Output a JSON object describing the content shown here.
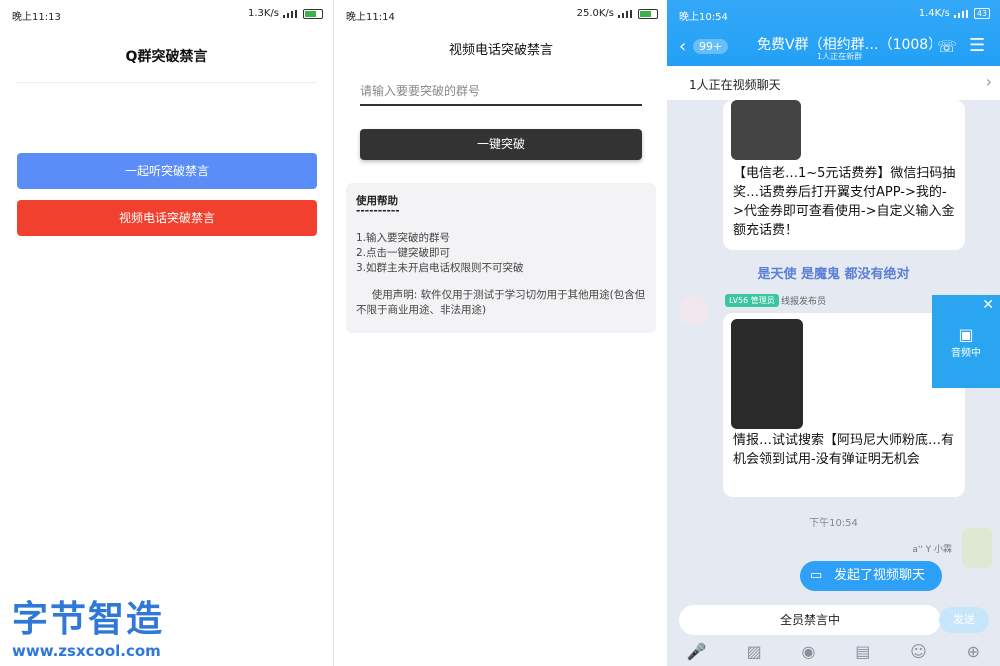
{
  "panel1": {
    "status": {
      "time": "晚上11:13",
      "speed": "1.3K/s"
    },
    "title": "Q群突破禁言",
    "buttons": {
      "listen": "一起听突破禁言",
      "video": "视频电话突破禁言"
    },
    "watermark": {
      "brand": "字节智造",
      "url": "www.zsxcool.com"
    },
    "colors": {
      "listen_btn": "#5b8df8",
      "video_btn": "#f2402f"
    }
  },
  "panel2": {
    "status": {
      "time": "晚上11:14",
      "speed": "25.0K/s"
    },
    "title": "视频电话突破禁言",
    "input_placeholder": "请输入要要突破的群号",
    "button": "一键突破",
    "help": {
      "title": "使用帮助",
      "divider": "----------",
      "steps": [
        "1.输入要突破的群号",
        "2.点击一键突破即可",
        "3.如群主未开启电话权限则不可突破"
      ],
      "disclaimer": "使用声明: 软件仅用于测试于学习切勿用于其他用途(包含但不限于商业用途、非法用途)"
    }
  },
  "panel3": {
    "status": {
      "time": "晚上10:54",
      "speed": "1.4K/s",
      "battery": "43"
    },
    "header": {
      "unread": "99+",
      "group_name": "免费V群（相约群…（1008）",
      "subtitle": "1人正在新群"
    },
    "video_bar": "1人正在视频聊天",
    "msg1": "【电信老…1~5元话费券】微信扫码抽奖…话费券后打开翼支付APP->我的->代金券即可查看使用->自定义输入金额充话费！",
    "notice": "是天使 是魔鬼 都没有绝对",
    "sender": {
      "level": "LV56 管理员",
      "name": "线报发布员"
    },
    "float_call": "音频中",
    "msg2": "情报…试试搜索【阿玛尼大师粉底…有机会领到试用-没有弹证明无机会",
    "timestamp": "下午10:54",
    "me_name": "a'' Y 小霖",
    "my_bubble": "发起了视频聊天",
    "input_text": "全员禁言中",
    "send_label": "发送",
    "toolbar_icons": [
      "mic-icon",
      "image-icon",
      "camera-icon",
      "redpacket-icon",
      "emoji-icon",
      "plus-icon"
    ]
  }
}
